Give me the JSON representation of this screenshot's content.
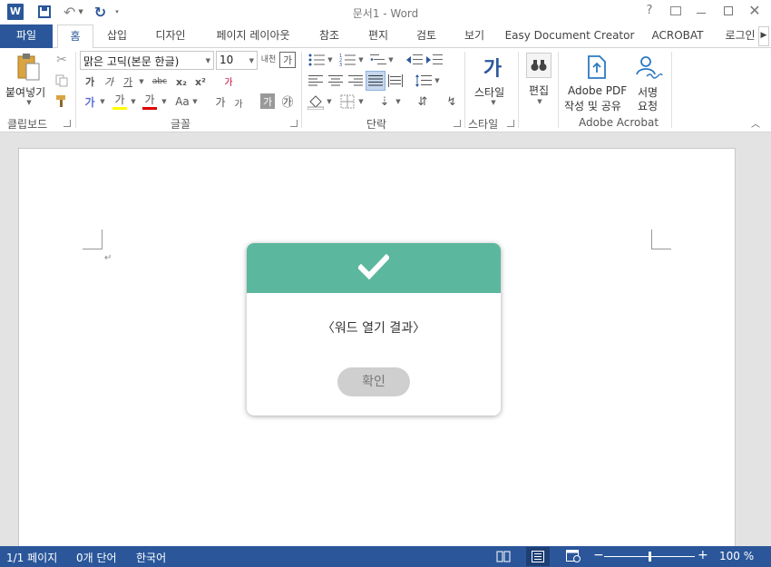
{
  "window": {
    "title": "문서1 - Word"
  },
  "quick_access": {
    "app_icon": "word-icon",
    "save": "save-icon",
    "undo": "undo-icon",
    "redo": "redo-icon",
    "customize": "customize-icon"
  },
  "window_controls": {
    "help": "?",
    "ribbon_display": "ribbon-display-icon",
    "minimize": "minimize-icon",
    "maximize": "maximize-icon",
    "close": "close-icon"
  },
  "tabs": [
    "파일",
    "홈",
    "삽입",
    "디자인",
    "페이지 레이아웃",
    "참조",
    "편지",
    "검토",
    "보기",
    "Easy Document Creator",
    "ACROBAT",
    "로그인"
  ],
  "ribbon": {
    "clipboard": {
      "paste_label": "붙여넣기",
      "group_label": "클립보드"
    },
    "font": {
      "font_name": "맑은 고딕(본문 한글)",
      "font_size": "10",
      "phonetic": "내천",
      "enclose": "가",
      "bold": "가",
      "italic": "가",
      "underline": "가",
      "strike": "abc",
      "subscript": "x₂",
      "superscript": "x²",
      "clear_format": "가",
      "text_effect": "가",
      "highlight": "가",
      "font_color": "가",
      "case": "Aa",
      "grow": "가",
      "shrink": "가",
      "char_shading": "가",
      "char_border": "㉮",
      "group_label": "글꼴"
    },
    "paragraph": {
      "group_label": "단락"
    },
    "styles": {
      "styles_label": "스타일",
      "group_label": "스타일",
      "style_glyph": "가"
    },
    "editing": {
      "edit_label": "편집"
    },
    "acrobat": {
      "create_pdf_line1": "Adobe PDF",
      "create_pdf_line2": "작성 및 공유",
      "sign_line1": "서명",
      "sign_line2": "요청",
      "group_label": "Adobe Acrobat"
    }
  },
  "document": {
    "paragraph_mark": "↵"
  },
  "dialog": {
    "icon": "checkmark-icon",
    "message": "〈워드 열기 결과〉",
    "ok_label": "확인",
    "header_color": "#5bb79e"
  },
  "status": {
    "page": "1/1 페이지",
    "words": "0개 단어",
    "language": "한국어",
    "zoom": "100 %",
    "zoom_level": 100
  },
  "colors": {
    "accent": "#2b579a",
    "highlight": "#ffff00",
    "font_color": "#e00000"
  }
}
